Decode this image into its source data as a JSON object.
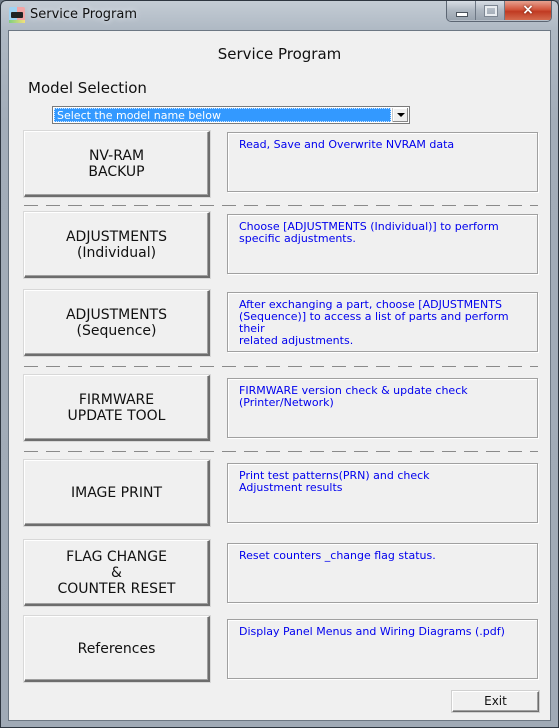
{
  "window": {
    "title": "Service Program",
    "icon": "printer-app-icon",
    "caption_buttons": {
      "minimize": "minimize",
      "maximize": "maximize",
      "close": "×"
    }
  },
  "header": {
    "title": "Service Program"
  },
  "model_selection": {
    "label": "Model Selection",
    "selected_value": "Select the model name below"
  },
  "functions": [
    {
      "button_label": "NV-RAM\nBACKUP",
      "description": "Read, Save and Overwrite NVRAM data"
    },
    {
      "button_label": "ADJUSTMENTS\n(Individual)",
      "description": "Choose [ADJUSTMENTS (Individual)] to perform\nspecific adjustments."
    },
    {
      "button_label": "ADJUSTMENTS\n(Sequence)",
      "description": "After exchanging a part, choose [ADJUSTMENTS\n(Sequence)] to access a list of parts and perform their\nrelated adjustments."
    },
    {
      "button_label": "FIRMWARE\nUPDATE TOOL",
      "description": "FIRMWARE version check & update check\n(Printer/Network)"
    },
    {
      "button_label": "IMAGE PRINT",
      "description": "Print test patterns(PRN) and check\n Adjustment results"
    },
    {
      "button_label": "FLAG CHANGE\n&\nCOUNTER RESET",
      "description": "Reset counters _change flag status."
    },
    {
      "button_label": "References",
      "description": "Display Panel Menus and Wiring Diagrams (.pdf)"
    }
  ],
  "footer": {
    "exit_label": "Exit"
  },
  "colors": {
    "description_text": "#0000ee",
    "selection_highlight": "#3399ff",
    "close_button": "#c8432a"
  }
}
